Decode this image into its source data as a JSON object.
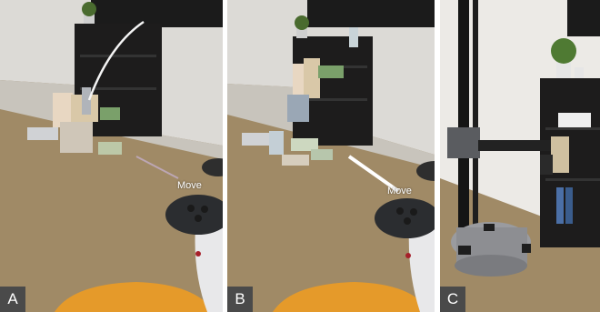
{
  "panels": [
    {
      "label": "A",
      "overlay_text": "Move"
    },
    {
      "label": "B",
      "overlay_text": "Move"
    },
    {
      "label": "C"
    }
  ],
  "colors": {
    "floor": "#a08a66",
    "wall": "#dcdad6",
    "shelf": "#1d1c1c",
    "robot": "#8d8e92",
    "chair": "#e59a2a",
    "controller": "#2b2d30",
    "label_bg": "#4a4a4a"
  }
}
